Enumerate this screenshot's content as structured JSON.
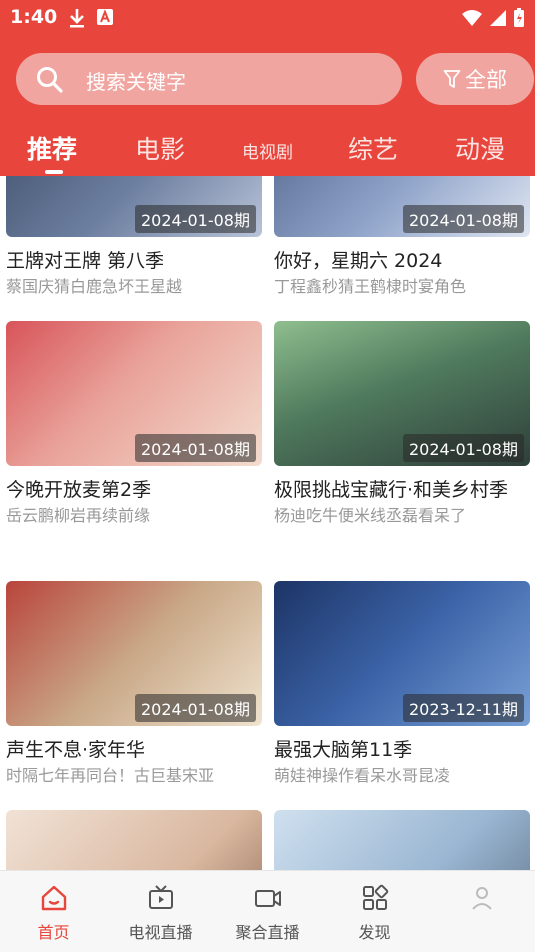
{
  "status": {
    "time": "1:40"
  },
  "search": {
    "placeholder": "搜索关键字",
    "filter_label": "全部"
  },
  "tabs": [
    {
      "label": "推荐",
      "active": true
    },
    {
      "label": "电影",
      "active": false
    },
    {
      "label": "电视剧",
      "active": false
    },
    {
      "label": "综艺",
      "active": false
    },
    {
      "label": "动漫",
      "active": false
    }
  ],
  "cards": [
    {
      "title": "王牌对王牌 第八季",
      "subtitle": "蔡国庆猜白鹿急坏王星越",
      "episode": "2024-01-08期",
      "color": "#5b6a86"
    },
    {
      "title": "你好，星期六 2024",
      "subtitle": "丁程鑫秒猜王鹤棣时宴角色",
      "episode": "2024-01-08期",
      "color": "#7a8fb8"
    },
    {
      "title": "今晚开放麦第2季",
      "subtitle": "岳云鹏柳岩再续前缘",
      "episode": "2024-01-08期",
      "color": "#c7565a"
    },
    {
      "title": "极限挑战宝藏行·和美乡村季",
      "subtitle": "杨迪吃牛便米线丞磊看呆了",
      "episode": "2024-01-08期",
      "color": "#5e8b6c"
    },
    {
      "title": "声生不息·家年华",
      "subtitle": "时隔七年再同台！古巨基宋亚",
      "episode": "2024-01-08期",
      "color": "#8a6a52"
    },
    {
      "title": "最强大脑第11季",
      "subtitle": "萌娃神操作看呆水哥昆凌",
      "episode": "2023-12-11期",
      "color": "#2e4f8a"
    },
    {
      "title": "",
      "subtitle": "",
      "episode": "",
      "color": "#e7d2c4"
    },
    {
      "title": "",
      "subtitle": "",
      "episode": "",
      "color": "#a9c2da"
    }
  ],
  "bottom_nav": [
    {
      "label": "首页",
      "icon": "home-icon",
      "active": true
    },
    {
      "label": "电视直播",
      "icon": "tv-icon",
      "active": false
    },
    {
      "label": "聚合直播",
      "icon": "camera-icon",
      "active": false
    },
    {
      "label": "发现",
      "icon": "grid-icon",
      "active": false
    },
    {
      "label": "",
      "icon": "user-icon",
      "active": false
    }
  ],
  "colors": {
    "brand": "#e8453c"
  }
}
